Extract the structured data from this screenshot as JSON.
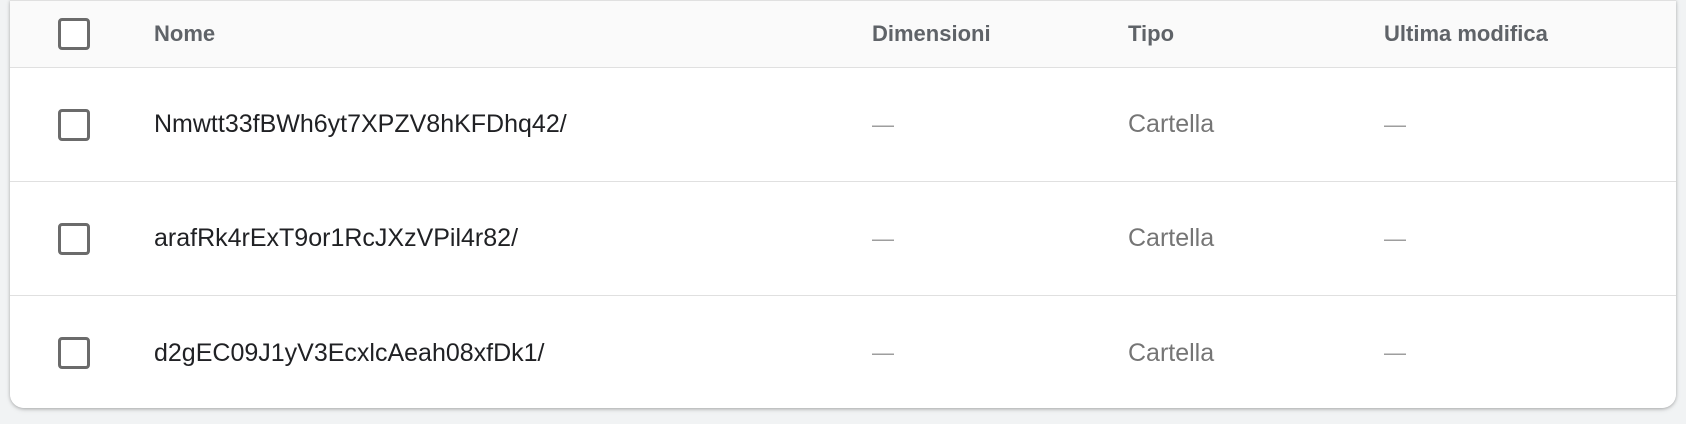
{
  "table": {
    "headers": {
      "name": "Nome",
      "size": "Dimensioni",
      "type": "Tipo",
      "modified": "Ultima modifica"
    },
    "rows": [
      {
        "name": "Nmwtt33fBWh6yt7XPZV8hKFDhq42/",
        "size": "—",
        "type": "Cartella",
        "modified": "—",
        "checked": false
      },
      {
        "name": "arafRk4rExT9or1RcJXzVPil4r82/",
        "size": "—",
        "type": "Cartella",
        "modified": "—",
        "checked": false
      },
      {
        "name": "d2gEC09J1yV3EcxlcAeah08xfDk1/",
        "size": "—",
        "type": "Cartella",
        "modified": "—",
        "checked": false
      }
    ]
  },
  "colors": {
    "header_bg": "#fafafa",
    "header_text": "#5f6368",
    "row_text": "#202124",
    "muted_text": "#757575",
    "divider": "#e0e0e0",
    "checkbox_border": "#6b6b6b"
  },
  "icons": {
    "select_all": "checkbox-unchecked-icon",
    "row_select": "checkbox-unchecked-icon"
  }
}
